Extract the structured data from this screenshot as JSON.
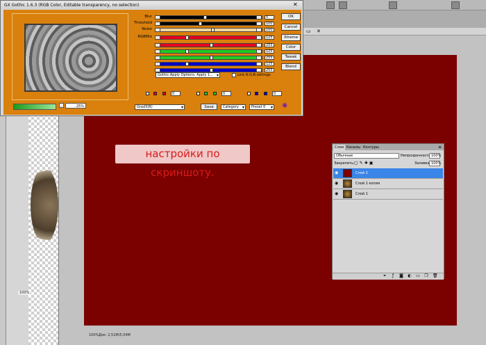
{
  "dialog": {
    "title": "GX Gothic 1.6.3 (RGB Color, Editable transparency, no selection)",
    "zoom": "25%",
    "sliders": [
      {
        "label": "Blur",
        "value": "5",
        "track": "#000000",
        "fill": 0.45
      },
      {
        "label": "Threshold",
        "value": "100",
        "track": "#000000",
        "fill": 0.4
      },
      {
        "label": "Noise",
        "value": "100",
        "track": "#f4d7a0",
        "fill": 0.53
      },
      {
        "label": "RGBMix",
        "value": "125",
        "track": "#e8001c",
        "fill": 0.26
      },
      {
        "label": "",
        "value": "255",
        "track": "#e8001c",
        "fill": 0.52
      },
      {
        "label": "",
        "value": "125",
        "track": "#22cc22",
        "fill": 0.26
      },
      {
        "label": "",
        "value": "255",
        "track": "#22cc22",
        "fill": 0.52
      },
      {
        "label": "",
        "value": "125",
        "track": "#0000cc",
        "fill": 0.26
      },
      {
        "label": "",
        "value": "255",
        "track": "#0000cc",
        "fill": 0.52
      }
    ],
    "buttons": [
      "OK",
      "Cancel",
      "Xtreme",
      "Color",
      "Tweak",
      "Blend"
    ],
    "options_select": "Gothic:Apply Options: Apply 1...",
    "link_label": "Link R-G-B settings",
    "mini_fields": [
      "0",
      "0",
      "0"
    ],
    "preset_select": "Grad3(R)",
    "save_label": "Save",
    "category_select": "Category",
    "preset_num_select": "Preset 0"
  },
  "canvas": {
    "caption": "настройки по скриншоту.",
    "status_zoom": "100%",
    "status_doc": "Док: 2,51M/5,04M",
    "left_zoom": "100%"
  },
  "layers_panel": {
    "tabs": [
      "Слои",
      "Каналы",
      "Контуры"
    ],
    "blend_mode": "Обычные",
    "opacity_label": "Непрозрачность:",
    "opacity_value": "100%",
    "lock_label": "Закрепить:",
    "fill_label": "Заливка:",
    "fill_value": "100%",
    "layers": [
      "Слой 2",
      "Слой 1 копия",
      "Слой 1"
    ]
  },
  "colors": {
    "canvas": "#7b0000",
    "dialog_body": "#d9800d",
    "selected_layer": "#3a85e8"
  }
}
